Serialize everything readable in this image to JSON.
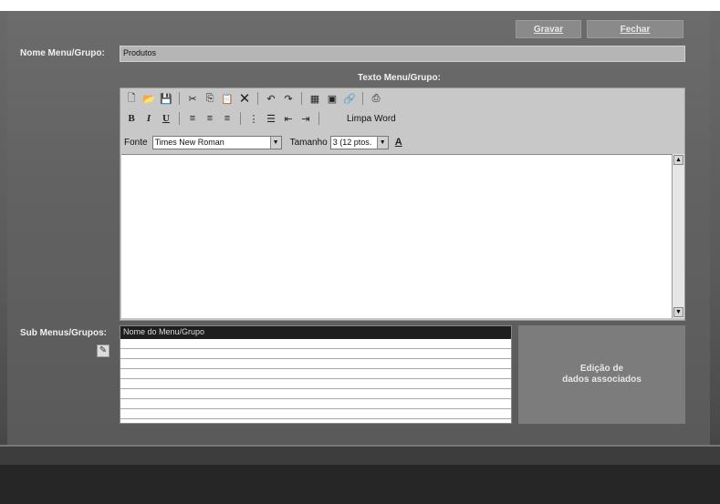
{
  "toolbar": {
    "save_label": "Gravar",
    "close_label": "Fechar"
  },
  "form": {
    "name_label": "Nome Menu/Grupo:",
    "name_value": "Produtos",
    "text_label": "Texto Menu/Grupo:",
    "submenus_label": "Sub Menus/Grupos:"
  },
  "editor": {
    "clean_word_label": "Limpa Word",
    "font_label": "Fonte",
    "font_value": "Times New Roman",
    "size_label": "Tamanho",
    "size_value": "3 (12 ptos.",
    "format_bold": "B",
    "format_italic": "I",
    "format_underline": "U",
    "color_glyph": "A"
  },
  "submenus": {
    "header": "Nome do Menu/Grupo",
    "rows": [
      "",
      "",
      "",
      "",
      "",
      "",
      "",
      ""
    ]
  },
  "assoc": {
    "line1": "Edição de",
    "line2": "dados associados"
  }
}
